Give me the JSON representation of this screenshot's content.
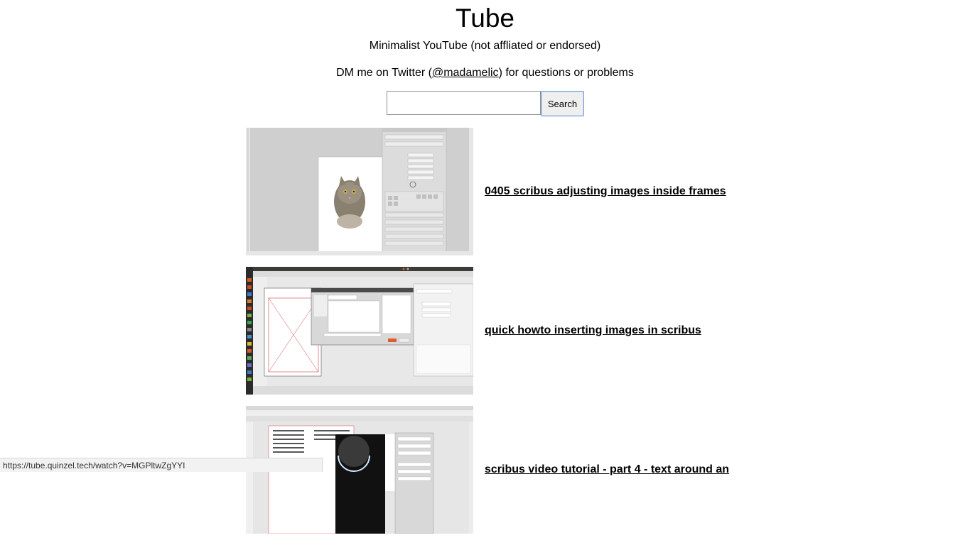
{
  "header": {
    "title": "Tube",
    "subtitle": "Minimalist YouTube (not affliated or endorsed)",
    "dm_prefix": "DM me on Twitter (",
    "dm_handle": "@madamelic",
    "dm_suffix": ") for questions or problems"
  },
  "search": {
    "value": "",
    "button_label": "Search"
  },
  "results": [
    {
      "title": "0405 scribus adjusting images inside frames",
      "thumbnail": "scribus-cat-image-frame"
    },
    {
      "title": "quick howto inserting images in scribus",
      "thumbnail": "scribus-insert-image-dialog"
    },
    {
      "title": "scribus video tutorial - part 4 - text around an",
      "thumbnail": "scribus-text-wrap-planet"
    }
  ],
  "status_bar": {
    "url": "https://tube.quinzel.tech/watch?v=MGPltwZgYYI"
  }
}
